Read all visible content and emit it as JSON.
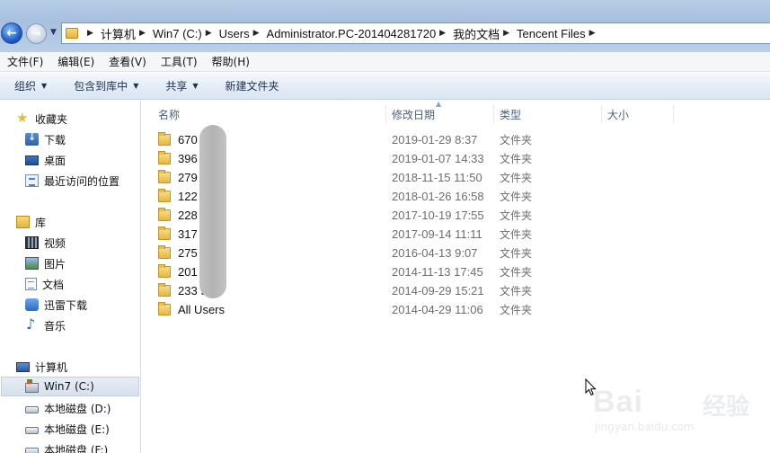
{
  "address_bar": {
    "breadcrumbs": [
      "计算机",
      "Win7 (C:)",
      "Users",
      "Administrator.PC-201404281720",
      "我的文档",
      "Tencent Files"
    ]
  },
  "menu_bar": [
    "文件(F)",
    "编辑(E)",
    "查看(V)",
    "工具(T)",
    "帮助(H)"
  ],
  "command_bar": {
    "organize": "组织",
    "include_in_library": "包含到库中",
    "share": "共享",
    "new_folder": "新建文件夹"
  },
  "nav_pane": {
    "favorites": {
      "title": "收藏夹",
      "items": [
        "下载",
        "桌面",
        "最近访问的位置"
      ]
    },
    "libraries": {
      "title": "库",
      "items": [
        "视频",
        "图片",
        "文档",
        "迅雷下载",
        "音乐"
      ]
    },
    "computer": {
      "title": "计算机",
      "items": [
        "Win7 (C:)",
        "本地磁盘 (D:)",
        "本地磁盘 (E:)",
        "本地磁盘 (F:)"
      ],
      "selected": "Win7 (C:)"
    }
  },
  "columns": {
    "name": "名称",
    "date_modified": "修改日期",
    "type": "类型",
    "size": "大小"
  },
  "files": [
    {
      "name": "670   30",
      "date": "2019-01-29 8:37",
      "type": "文件夹"
    },
    {
      "name": "396   68",
      "date": "2019-01-07 14:33",
      "type": "文件夹"
    },
    {
      "name": "279   767",
      "date": "2018-11-15 11:50",
      "type": "文件夹"
    },
    {
      "name": "122   76",
      "date": "2018-01-26 16:58",
      "type": "文件夹"
    },
    {
      "name": "228   619",
      "date": "2017-10-19 17:55",
      "type": "文件夹"
    },
    {
      "name": "317   41",
      "date": "2017-09-14 11:11",
      "type": "文件夹"
    },
    {
      "name": "275   085",
      "date": "2016-04-13 9:07",
      "type": "文件夹"
    },
    {
      "name": "201   953",
      "date": "2014-11-13 17:45",
      "type": "文件夹"
    },
    {
      "name": "233   97",
      "date": "2014-09-29 15:21",
      "type": "文件夹"
    },
    {
      "name": "All Users",
      "date": "2014-04-29 11:06",
      "type": "文件夹"
    }
  ],
  "watermark": {
    "brand": "Bai  ",
    "brand_cn": "经验",
    "url": "jingyan.baidu.com"
  }
}
